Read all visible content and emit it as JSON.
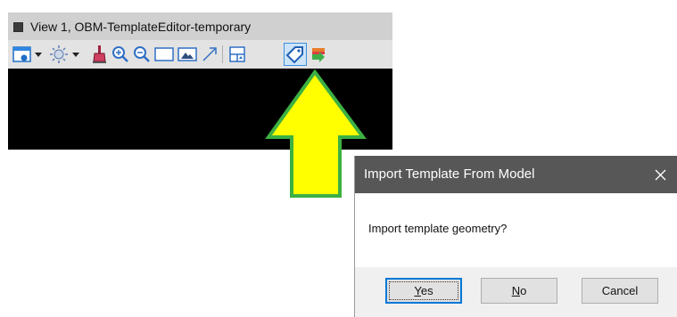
{
  "view_window": {
    "title": "View 1, OBM-TemplateEditor-temporary",
    "toolbar_icons": [
      "view-display-icon",
      "dropdown-arrow-icon",
      "lighting-icon",
      "dropdown-arrow-icon",
      "paint-bucket-icon",
      "zoom-in-icon",
      "zoom-out-icon",
      "window-area-icon",
      "fit-view-icon",
      "rotate-view-icon",
      "copy-view-icon",
      "tag-icon",
      "import-icon"
    ]
  },
  "dialog": {
    "title": "Import Template From Model",
    "close_icon": "close-icon",
    "message": "Import template geometry?",
    "buttons": {
      "yes": {
        "mnemonic": "Y",
        "rest": "es"
      },
      "no": {
        "mnemonic": "N",
        "rest": "o"
      },
      "cancel": {
        "label": "Cancel"
      }
    }
  },
  "annotation": {
    "arrow_fill": "#ffff00",
    "arrow_stroke": "#3cb043"
  },
  "colors": {
    "dialog_titlebar": "#575757",
    "default_button_border": "#0078d7",
    "canvas": "#000000"
  }
}
